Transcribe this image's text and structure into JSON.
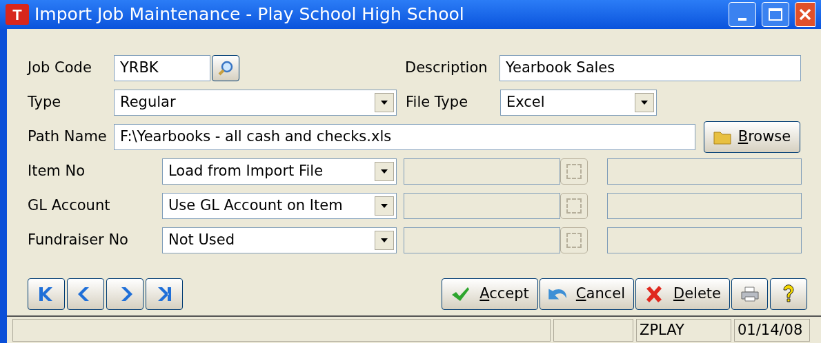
{
  "window": {
    "title": "Import Job Maintenance - Play School High School",
    "app_letter": "T"
  },
  "job_code": {
    "label": "Job Code",
    "value": "YRBK"
  },
  "description": {
    "label": "Description",
    "value": "Yearbook Sales"
  },
  "type": {
    "label": "Type",
    "value": "Regular"
  },
  "file_type": {
    "label": "File Type",
    "value": "Excel"
  },
  "path_name": {
    "label": "Path Name",
    "value": "F:\\Yearbooks - all cash and checks.xls"
  },
  "browse_button": "Browse",
  "sources": [
    {
      "label": "Item No",
      "value": "Load from Import File",
      "lookup_disabled": true
    },
    {
      "label": "GL Account",
      "value": "Use GL Account on Item",
      "lookup_disabled": true
    },
    {
      "label": "Fundraiser No",
      "value": "Not Used",
      "lookup_disabled": true
    }
  ],
  "actions": [
    {
      "label": "Accept",
      "kind": "accept"
    },
    {
      "label": "Cancel",
      "kind": "cancel"
    },
    {
      "label": "Delete",
      "kind": "delete"
    }
  ],
  "status_bar": [
    "ZPLAY",
    "01/14/08"
  ]
}
